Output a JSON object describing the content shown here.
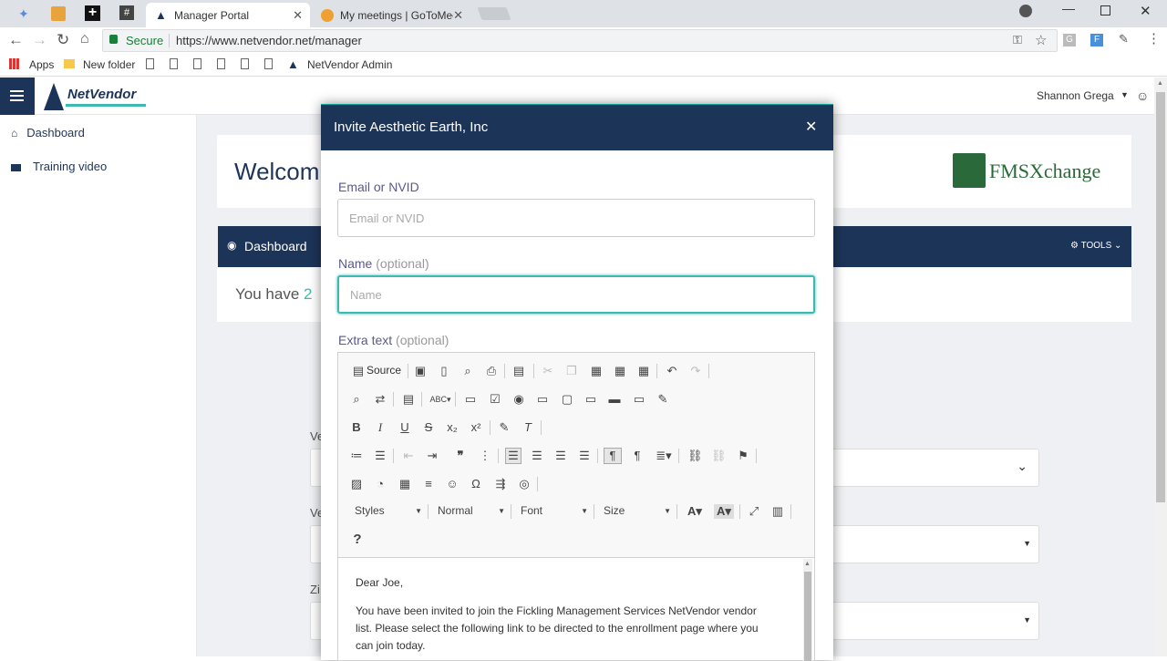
{
  "browser": {
    "tabs": [
      {
        "label": "Manager Portal",
        "icon": "netvendor-icon"
      },
      {
        "label": "My meetings | GoToMeeti",
        "icon": "gotomeeting-icon"
      }
    ],
    "url": "https://www.netvendor.net/manager",
    "secure_label": "Secure",
    "bookmarks": {
      "apps": "Apps",
      "folder": "New folder",
      "admin": "NetVendor Admin"
    }
  },
  "header": {
    "logo_text": "NetVendor",
    "user": "Shannon Grega"
  },
  "sidebar": {
    "items": [
      {
        "label": "Dashboard",
        "icon": "home-icon"
      },
      {
        "label": "Training video",
        "icon": "video-icon"
      }
    ]
  },
  "main": {
    "welcome": "Welcom",
    "partner_logo": "FMSXchange",
    "dashboard_bar": "Dashboard",
    "tools": "TOOLS",
    "you_have": "You have",
    "count": "2",
    "field_labels": [
      "Ve",
      "Ve",
      "Zi"
    ]
  },
  "modal": {
    "title": "Invite Aesthetic Earth, Inc",
    "email_label": "Email or NVID",
    "email_placeholder": "Email or NVID",
    "name_label": "Name",
    "name_optional": "(optional)",
    "name_placeholder": "Name",
    "extra_label": "Extra text",
    "extra_optional": "(optional)",
    "toolbar": {
      "source": "Source",
      "styles": "Styles",
      "format": "Normal",
      "font": "Font",
      "size": "Size",
      "help": "?"
    },
    "body": {
      "greeting": "Dear Joe,",
      "line1": "You have been invited to join the Fickling Management Services NetVendor vendor",
      "line2": "list. Please select the following link to be directed to the enrollment page where you",
      "line3": "can join today."
    }
  },
  "colors": {
    "navy": "#1d3459",
    "teal": "#3cb9b0"
  }
}
